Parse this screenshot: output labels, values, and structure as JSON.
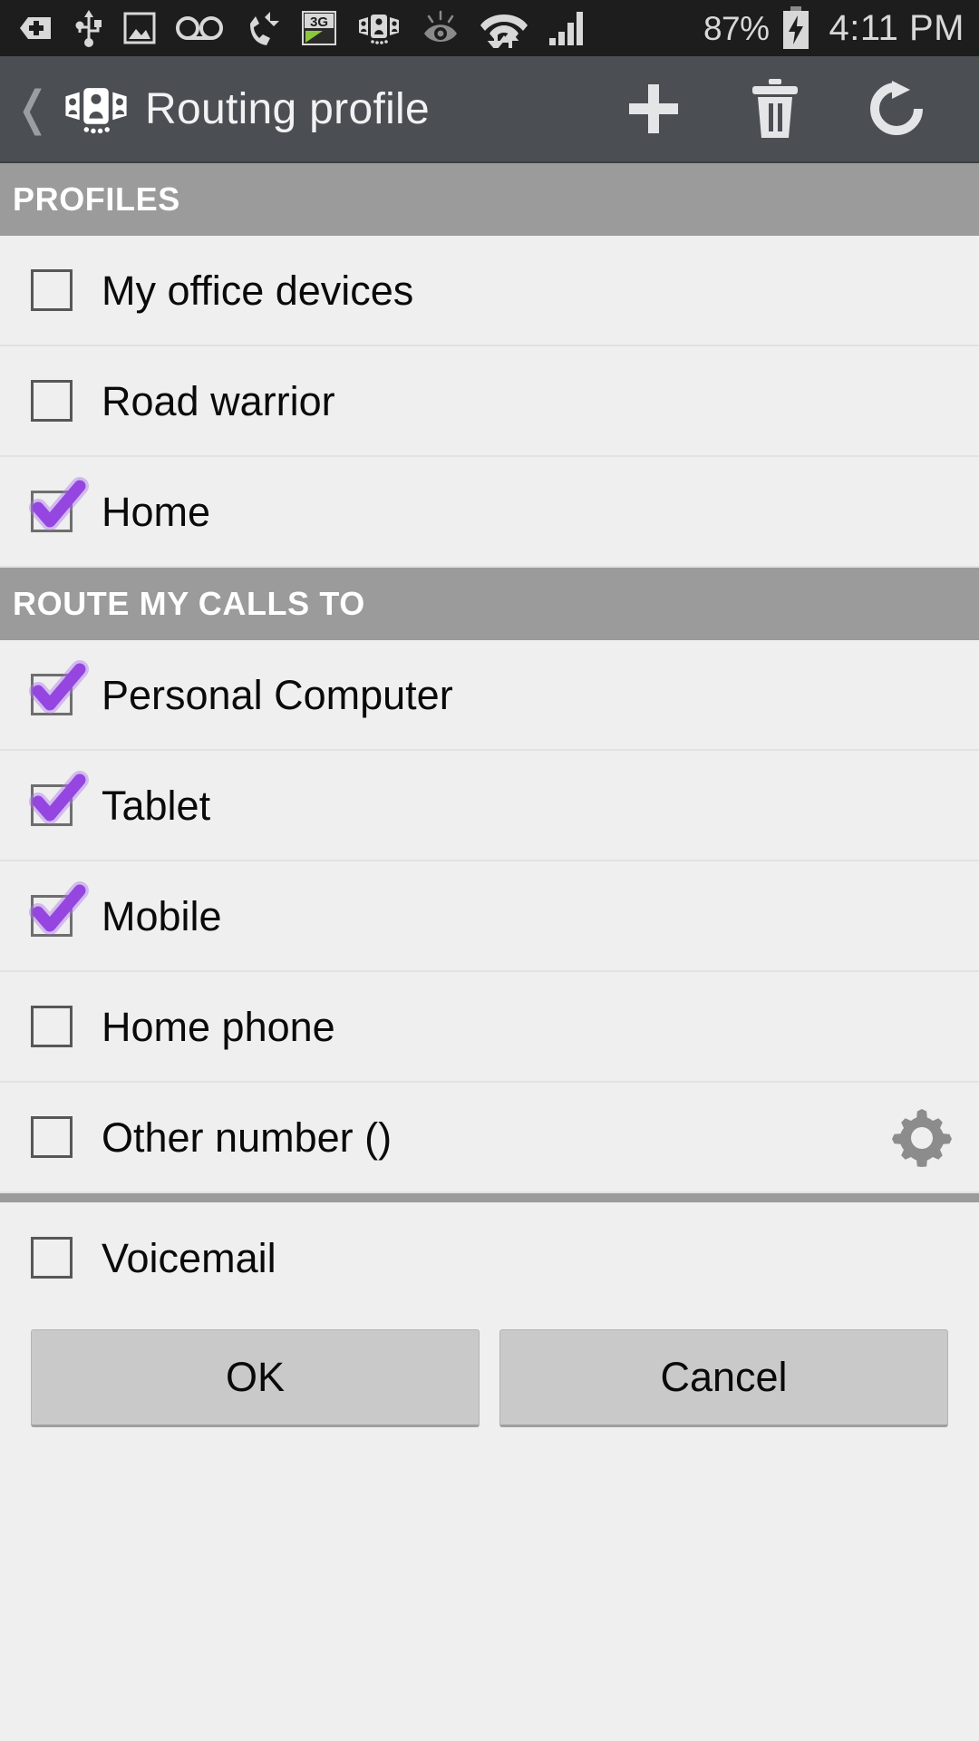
{
  "statusbar": {
    "icons": [
      "add-badge-icon",
      "usb-icon",
      "picture-icon",
      "voicemail-icon",
      "missed-call-icon",
      "3g-data-icon",
      "conference-icon",
      "smart-stay-eye-icon",
      "wifi-icon",
      "signal-bars-icon"
    ],
    "battery_percent": "87%",
    "battery_state": "charging",
    "time": "4:11 PM"
  },
  "actionbar": {
    "back_icon": "back-chevron-icon",
    "app_icon": "conference-icon",
    "title": "Routing profile",
    "actions": [
      {
        "name": "add-button",
        "icon": "plus-icon"
      },
      {
        "name": "delete-button",
        "icon": "trash-icon"
      },
      {
        "name": "refresh-button",
        "icon": "refresh-icon"
      }
    ]
  },
  "sections": [
    {
      "header": "PROFILES",
      "rows": [
        {
          "label": "My office devices",
          "checked": false,
          "gear": false
        },
        {
          "label": "Road warrior",
          "checked": false,
          "gear": false
        },
        {
          "label": "Home",
          "checked": true,
          "gear": false
        }
      ]
    },
    {
      "header": "ROUTE MY CALLS TO",
      "rows": [
        {
          "label": "Personal Computer",
          "checked": true,
          "gear": false
        },
        {
          "label": "Tablet",
          "checked": true,
          "gear": false
        },
        {
          "label": "Mobile",
          "checked": true,
          "gear": false
        },
        {
          "label": "Home phone",
          "checked": false,
          "gear": false
        },
        {
          "label": "Other number ()",
          "checked": false,
          "gear": true
        }
      ]
    }
  ],
  "trailing_rows": [
    {
      "label": "Voicemail",
      "checked": false,
      "gear": false
    }
  ],
  "buttons": {
    "ok": "OK",
    "cancel": "Cancel"
  },
  "colors": {
    "accent_check": "#9546e0",
    "actionbar_bg": "#4b4f54",
    "section_header_bg": "#9b9b9b",
    "list_bg": "#efeff0",
    "statusbar_bg": "#1d1d1d",
    "button_bg": "#c9c9c9"
  }
}
